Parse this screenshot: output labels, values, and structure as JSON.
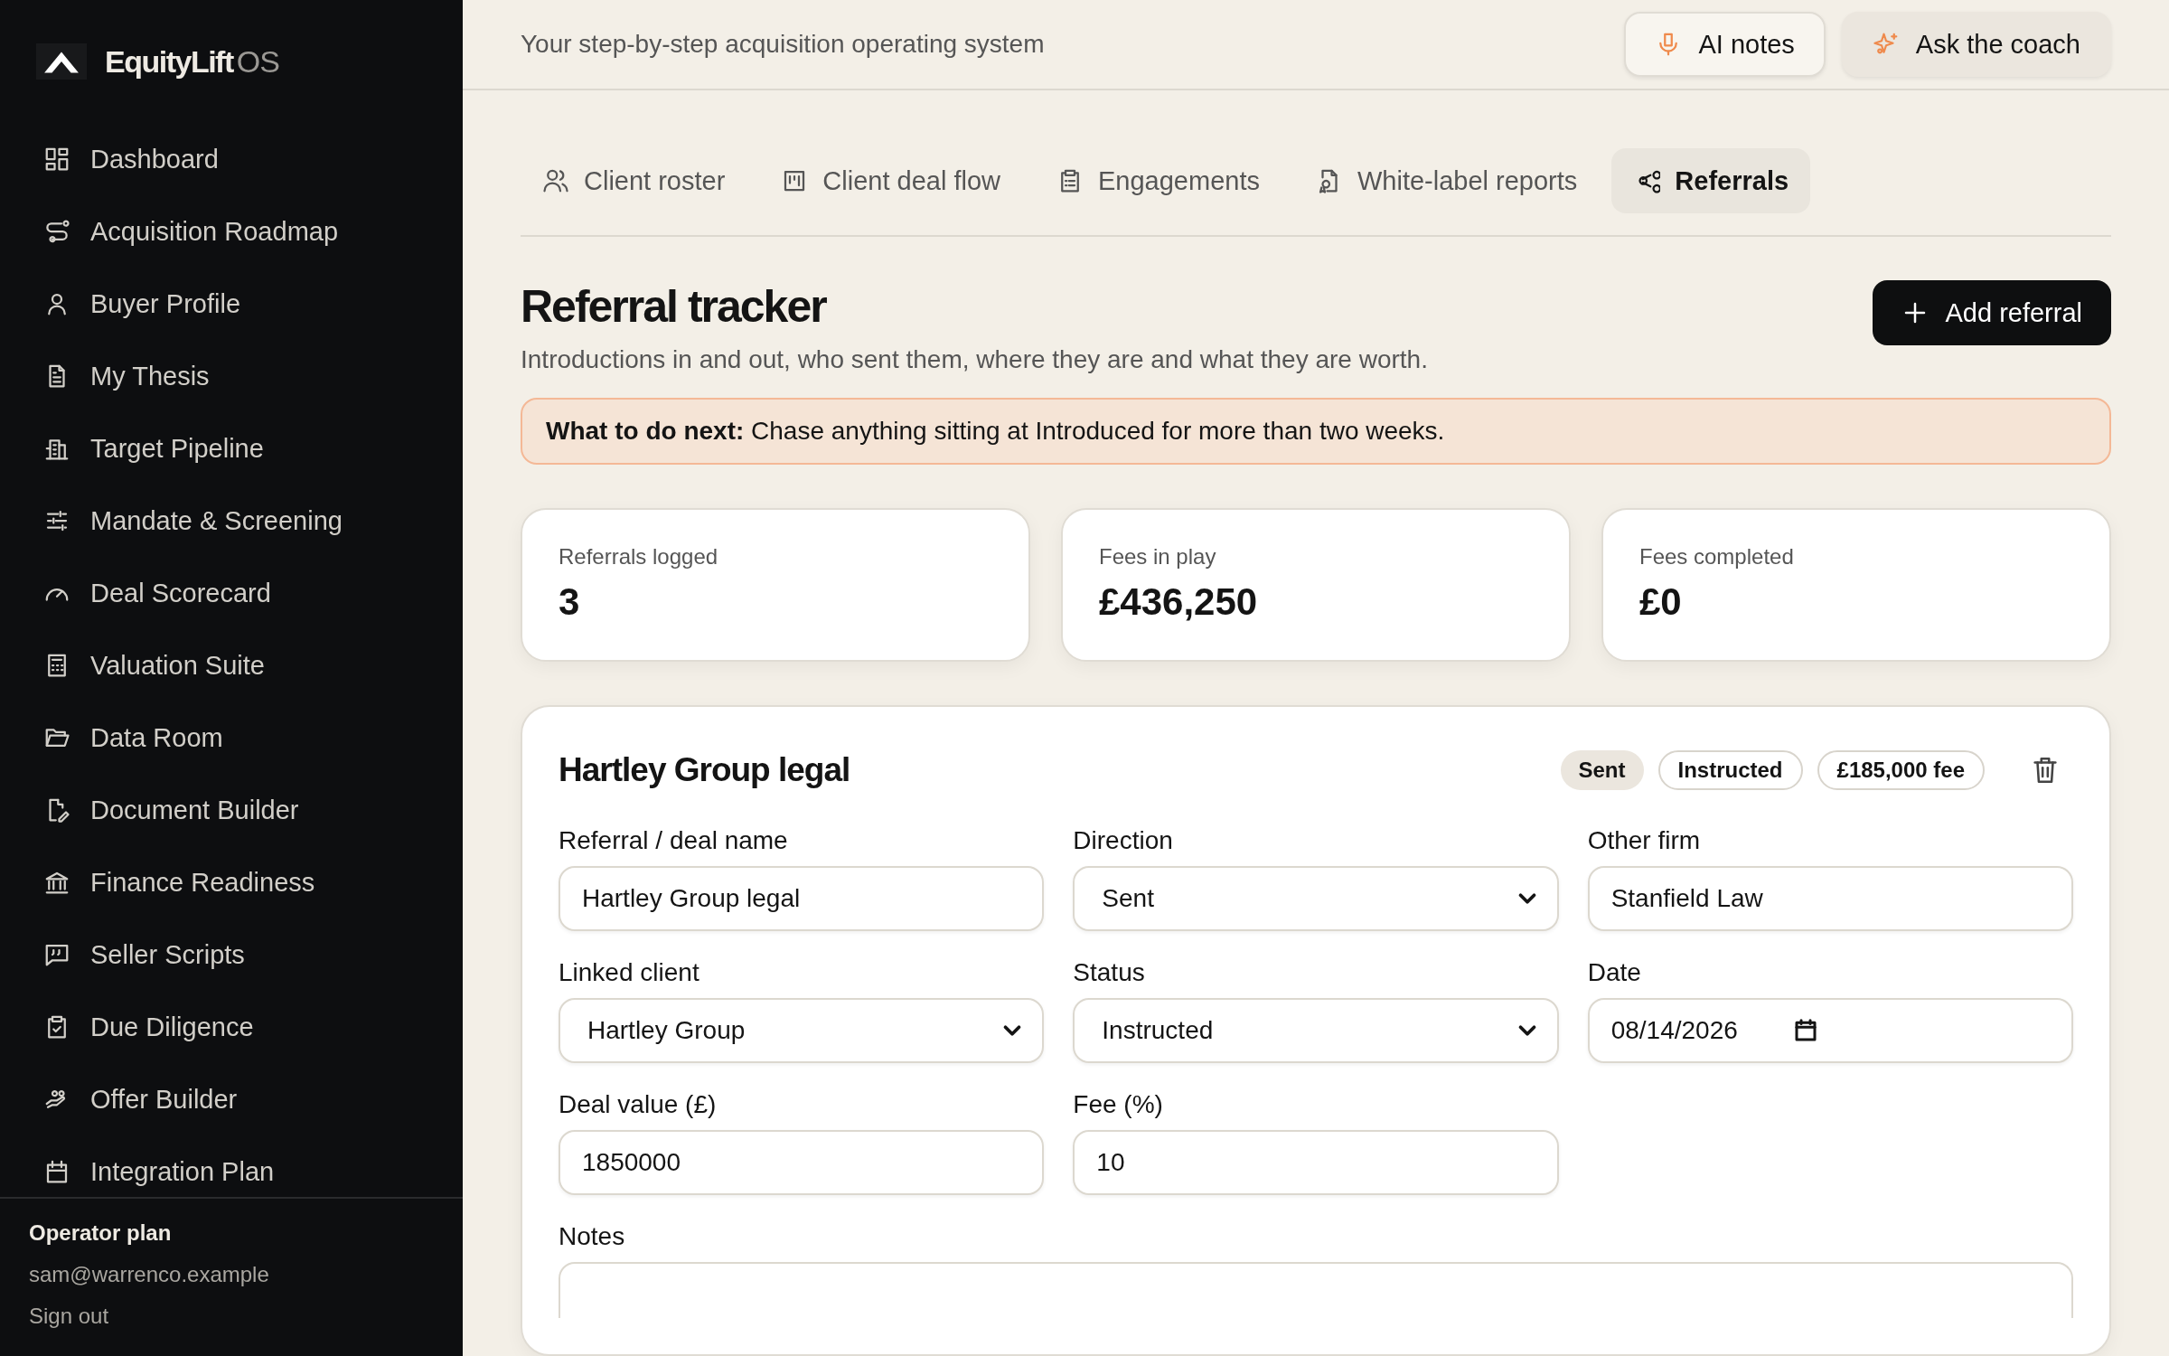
{
  "sidebar": {
    "brand": {
      "name": "EquityLift",
      "suffix": "OS"
    },
    "items": [
      {
        "label": "Dashboard"
      },
      {
        "label": "Acquisition Roadmap"
      },
      {
        "label": "Buyer Profile"
      },
      {
        "label": "My Thesis"
      },
      {
        "label": "Target Pipeline"
      },
      {
        "label": "Mandate & Screening"
      },
      {
        "label": "Deal Scorecard"
      },
      {
        "label": "Valuation Suite"
      },
      {
        "label": "Data Room"
      },
      {
        "label": "Document Builder"
      },
      {
        "label": "Finance Readiness"
      },
      {
        "label": "Seller Scripts"
      },
      {
        "label": "Due Diligence"
      },
      {
        "label": "Offer Builder"
      },
      {
        "label": "Integration Plan"
      }
    ],
    "footer": {
      "plan": "Operator plan",
      "email": "sam@warrenco.example",
      "sign_out": "Sign out"
    }
  },
  "header": {
    "tagline": "Your step-by-step acquisition operating system",
    "buttons": [
      {
        "label": "AI notes",
        "kind": "outline"
      },
      {
        "label": "Ask the coach",
        "kind": "soft"
      }
    ]
  },
  "tabs": [
    {
      "label": "Client roster",
      "selected": false
    },
    {
      "label": "Client deal flow",
      "selected": false
    },
    {
      "label": "Engagements",
      "selected": false
    },
    {
      "label": "White-label reports",
      "selected": false
    },
    {
      "label": "Referrals",
      "selected": true
    }
  ],
  "page": {
    "title": "Referral tracker",
    "subtitle": "Introductions in and out, who sent them, where they are and what they are worth.",
    "add_button": "Add referral",
    "hint": "**What to do next:** Chase anything sitting at Introduced for more than two weeks."
  },
  "stats": [
    {
      "label": "Referrals logged",
      "value": "3"
    },
    {
      "label": "Fees in play",
      "value": "£436,250"
    },
    {
      "label": "Fees completed",
      "value": "£0"
    }
  ],
  "referral": {
    "title": "Hartley Group legal",
    "badges": [
      {
        "text": "Sent",
        "kind": "filled"
      },
      {
        "text": "Instructed",
        "kind": "outline"
      },
      {
        "text": "£185,000 fee",
        "kind": "outline"
      }
    ],
    "fields": [
      {
        "label": "Referral / deal name",
        "value": "Hartley Group legal",
        "kind": "text"
      },
      {
        "label": "Direction",
        "value": "Sent",
        "kind": "select"
      },
      {
        "label": "Other firm",
        "value": "Stanfield Law",
        "kind": "text"
      },
      {
        "label": "Linked client",
        "value": "Hartley Group",
        "kind": "select"
      },
      {
        "label": "Status",
        "value": "Instructed",
        "kind": "select"
      },
      {
        "label": "Date",
        "value": "08/14/2026",
        "kind": "date"
      },
      {
        "label": "Deal value (£)",
        "value": "1850000",
        "kind": "text"
      },
      {
        "label": "Fee (%)",
        "value": "10",
        "kind": "text"
      }
    ],
    "notes": {
      "label": "Notes"
    }
  }
}
